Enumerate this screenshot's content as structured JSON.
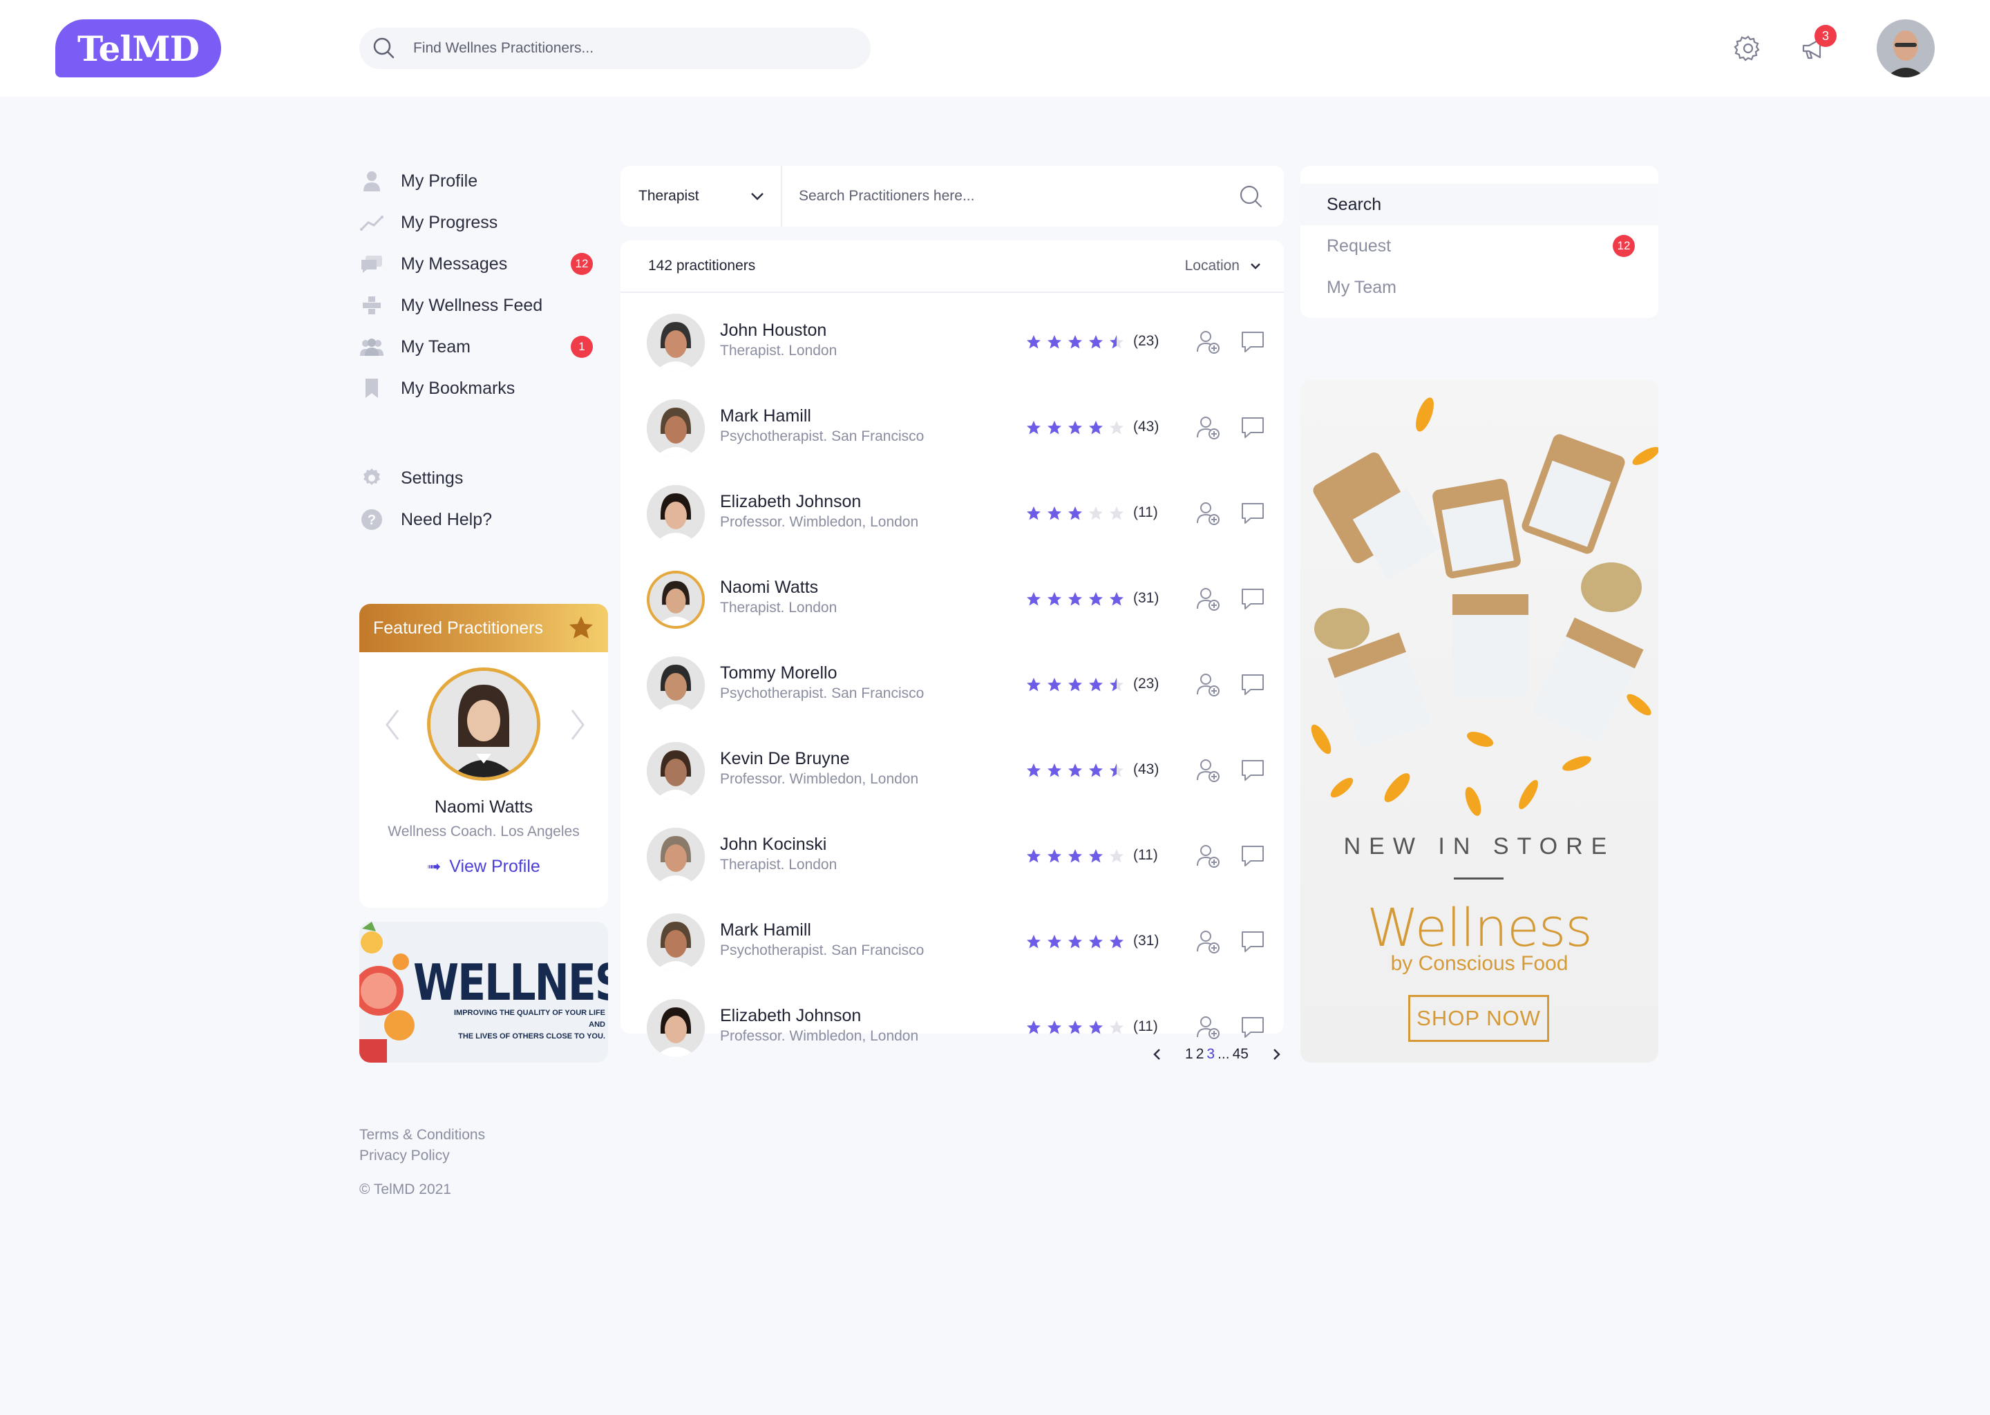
{
  "app": {
    "logo": "TelMD"
  },
  "header": {
    "search_placeholder": "Find Wellnes Practitioners...",
    "notification_count": "3"
  },
  "sidebar": {
    "items": [
      {
        "label": "My Profile",
        "icon": "person-icon"
      },
      {
        "label": "My Progress",
        "icon": "progress-chart-icon"
      },
      {
        "label": "My Messages",
        "icon": "messages-icon",
        "badge": "12"
      },
      {
        "label": "My Wellness Feed",
        "icon": "feed-icon"
      },
      {
        "label": "My Team",
        "icon": "team-icon",
        "badge": "1"
      },
      {
        "label": "My Bookmarks",
        "icon": "bookmark-icon"
      }
    ],
    "secondary": [
      {
        "label": "Settings",
        "icon": "gear-icon"
      },
      {
        "label": "Need Help?",
        "icon": "help-icon"
      }
    ]
  },
  "featured": {
    "title": "Featured Practitioners",
    "name": "Naomi Watts",
    "role": "Wellness Coach. Los Angeles",
    "link": "View Profile"
  },
  "ad_small": {
    "title": "WELLNESS",
    "subtitle_1": "IMPROVING THE QUALITY OF YOUR LIFE AND",
    "subtitle_2": "THE LIVES OF OTHERS CLOSE TO YOU."
  },
  "footer": {
    "terms": "Terms & Conditions",
    "privacy": "Privacy Policy",
    "copyright": "© TelMD 2021"
  },
  "filter": {
    "category": "Therapist",
    "search_placeholder": "Search Practitioners here..."
  },
  "list": {
    "count_label": "142 practitioners",
    "location_label": "Location",
    "practitioners": [
      {
        "name": "John Houston",
        "role": "Therapist. London",
        "rating": 4.5,
        "reviews": "(23)"
      },
      {
        "name": "Mark Hamill",
        "role": "Psychotherapist. San Francisco",
        "rating": 4,
        "reviews": "(43)"
      },
      {
        "name": "Elizabeth Johnson",
        "role": "Professor. Wimbledon, London",
        "rating": 3,
        "reviews": "(11)"
      },
      {
        "name": "Naomi Watts",
        "role": "Therapist. London",
        "rating": 5,
        "reviews": "(31)",
        "featured": true
      },
      {
        "name": "Tommy Morello",
        "role": "Psychotherapist. San Francisco",
        "rating": 4.5,
        "reviews": "(23)"
      },
      {
        "name": "Kevin De Bruyne",
        "role": "Professor. Wimbledon, London",
        "rating": 4.5,
        "reviews": "(43)"
      },
      {
        "name": "John Kocinski",
        "role": "Therapist. London",
        "rating": 4,
        "reviews": "(11)"
      },
      {
        "name": "Mark Hamill",
        "role": "Psychotherapist. San Francisco",
        "rating": 5,
        "reviews": "(31)"
      },
      {
        "name": "Elizabeth Johnson",
        "role": "Professor. Wimbledon, London",
        "rating": 4,
        "reviews": "(11)"
      }
    ]
  },
  "pagination": {
    "pages": [
      "1",
      "2",
      "3"
    ],
    "active": "3",
    "ellipsis": "...",
    "last": "45"
  },
  "right_tabs": {
    "items": [
      {
        "label": "Search",
        "active": true
      },
      {
        "label": "Request",
        "badge": "12"
      },
      {
        "label": "My Team"
      }
    ]
  },
  "ad_big": {
    "tagline": "NEW IN STORE",
    "title": "Wellness",
    "subtitle": "by Conscious Food",
    "cta": "SHOP NOW"
  },
  "colors": {
    "brand": "#7b5cf5",
    "star": "#6c5ce7",
    "badge": "#f03b48",
    "link": "#4c3fd8",
    "accent_gold": "#d59a36"
  }
}
